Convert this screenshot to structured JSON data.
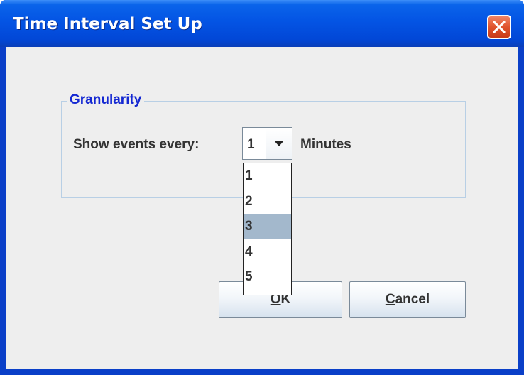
{
  "window": {
    "title": "Time Interval Set Up"
  },
  "granularity": {
    "group_title": "Granularity",
    "label": "Show events every:",
    "selected_value": "1",
    "unit": "Minutes",
    "options": [
      "1",
      "2",
      "3",
      "4",
      "5"
    ],
    "highlighted_option": "3"
  },
  "buttons": {
    "ok_mnemonic": "O",
    "ok_rest": "K",
    "cancel_mnemonic": "C",
    "cancel_rest": "ancel"
  },
  "colors": {
    "title_bar": "#0454e4",
    "group_title": "#1428d2",
    "highlight": "#a3b8cc",
    "close_button": "#e0532d"
  },
  "icons": {
    "close": "close-icon",
    "dropdown": "chevron-down-icon"
  }
}
